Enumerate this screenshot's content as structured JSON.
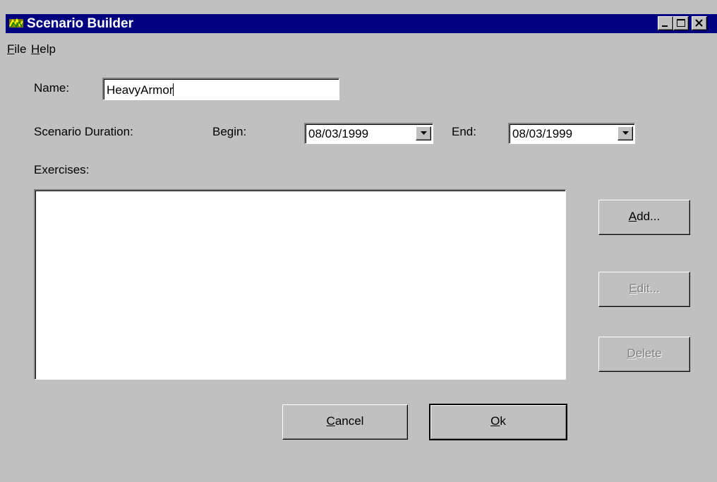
{
  "window": {
    "title": "Scenario Builder"
  },
  "menu": [
    {
      "key": "F",
      "rest": "ile"
    },
    {
      "key": "H",
      "rest": "elp"
    }
  ],
  "form": {
    "name_label": "Name:",
    "name_value": "HeavyArmor",
    "duration_label": "Scenario Duration:",
    "begin_label": "Begin:",
    "begin_value": "08/03/1999",
    "end_label": "End:",
    "end_value": "08/03/1999",
    "exercises_label": "Exercises:"
  },
  "buttons": {
    "add": {
      "key": "A",
      "rest": "dd..."
    },
    "edit": {
      "key": "E",
      "rest": "dit..."
    },
    "delete": {
      "key": "D",
      "rest": "elete"
    },
    "cancel": {
      "key": "C",
      "rest": "ancel"
    },
    "ok": {
      "key": "O",
      "rest": "k"
    }
  }
}
